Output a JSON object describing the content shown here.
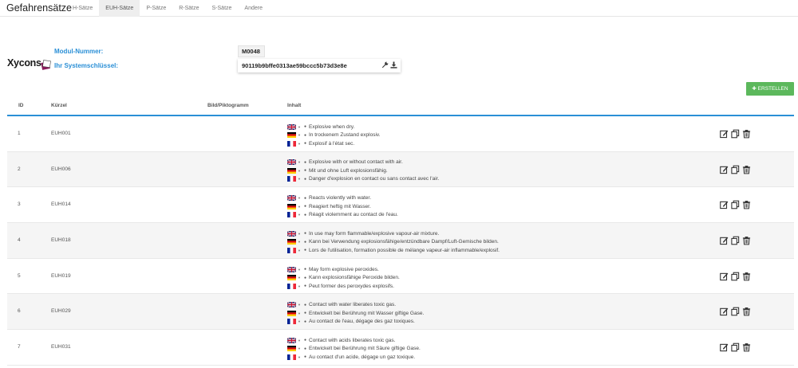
{
  "header": {
    "title": "Gefahrensätze",
    "tabs": [
      {
        "label": "H-Sätze",
        "active": false
      },
      {
        "label": "EUH-Sätze",
        "active": true
      },
      {
        "label": "P-Sätze",
        "active": false
      },
      {
        "label": "R-Sätze",
        "active": false
      },
      {
        "label": "S-Sätze",
        "active": false
      },
      {
        "label": "Andere",
        "active": false
      }
    ]
  },
  "brand": {
    "logo_text": "Xycons"
  },
  "module": {
    "number_label": "Modul-Nummer:",
    "number_value": "M0048",
    "key_label": "Ihr Systemschlüssel:",
    "key_value": "90119b9bffe0313ae59bccc5b73d3e8e"
  },
  "actions": {
    "create_label": "✚ ERSTELLEN"
  },
  "table": {
    "columns": [
      "ID",
      "Kürzel",
      "Bild/Piktogramm",
      "Inhalt"
    ],
    "rows": [
      {
        "id": "1",
        "code": "EUH001",
        "texts": [
          "Explosive when dry.",
          "In trockenem Zustand explosiv.",
          "Explosif à l'état sec."
        ]
      },
      {
        "id": "2",
        "code": "EUH006",
        "texts": [
          "Explosive with or without contact with air.",
          "Mit und ohne Luft explosionsfähig.",
          "Danger d'explosion en contact ou sans contact avec l'air."
        ]
      },
      {
        "id": "3",
        "code": "EUH014",
        "texts": [
          "Reacts violently with water.",
          "Reagiert heftig mit Wasser.",
          "Réagit violemment au contact de l'eau."
        ]
      },
      {
        "id": "4",
        "code": "EUH018",
        "texts": [
          "In use may form flammable/explosive vapour-air mixture.",
          "Kann bei Verwendung explosionsfähige/entzündbare Dampf/Luft-Gemische bilden.",
          "Lors de l'utilisation, formation possible de mélange vapeur-air inflammable/explosif."
        ]
      },
      {
        "id": "5",
        "code": "EUH019",
        "texts": [
          "May form explosive peroxides.",
          "Kann explosionsfähige Peroxide bilden.",
          "Peut former des peroxydes explosifs."
        ]
      },
      {
        "id": "6",
        "code": "EUH029",
        "texts": [
          "Contact with water liberates toxic gas.",
          "Entwickelt bei Berührung mit Wasser giftige Gase.",
          "Au contact de l'eau, dégage des gaz toxiques."
        ]
      },
      {
        "id": "7",
        "code": "EUH031",
        "texts": [
          "Contact with acids liberates toxic gas.",
          "Entwickelt bei Berührung mit Säure giftige Gase.",
          "Au contact d'un acide, dégage un gaz toxique."
        ]
      }
    ]
  },
  "colors": {
    "accent": "#2a8fd6",
    "create_button": "#5cb85c",
    "stripe": "#f5f5f5"
  },
  "icons": {
    "flags": [
      "flag-uk-icon",
      "flag-de-icon",
      "flag-fr-icon"
    ],
    "row_actions": [
      "edit-icon",
      "copy-icon",
      "delete-icon"
    ],
    "key_actions": [
      "wrench-icon",
      "download-icon"
    ]
  }
}
